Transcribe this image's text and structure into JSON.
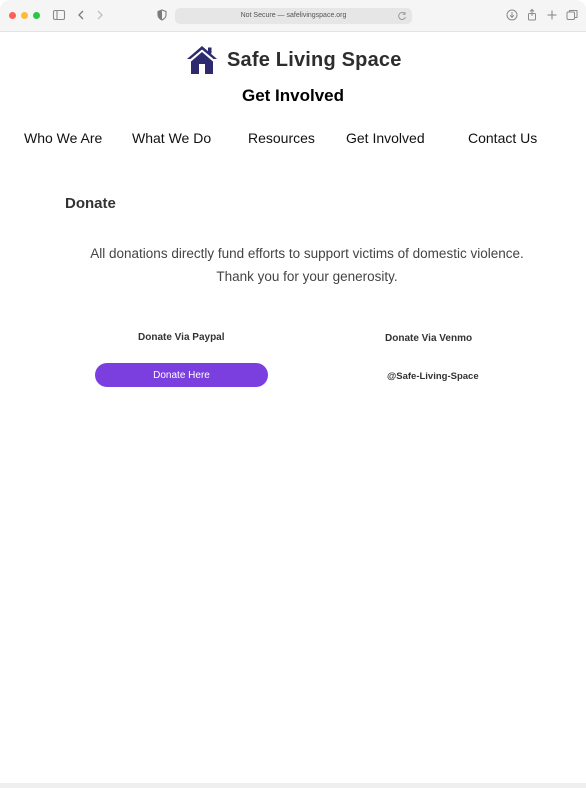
{
  "browser": {
    "address_text": "Not Secure — safelivingspace.org",
    "icons": [
      "sidebar-icon",
      "back-icon",
      "forward-icon",
      "privacy-shield-icon",
      "reload-icon",
      "download-icon",
      "share-icon",
      "new-tab-icon",
      "tabs-overview-icon"
    ]
  },
  "site": {
    "name": "Safe Living Space",
    "page_title": "Get Involved",
    "brand_color": "#2e2a6e"
  },
  "nav": {
    "items": [
      {
        "label": "Who We Are"
      },
      {
        "label": "What We Do"
      },
      {
        "label": "Resources"
      },
      {
        "label": "Get Involved"
      },
      {
        "label": "Contact Us"
      }
    ]
  },
  "donate": {
    "heading": "Donate",
    "blurb_line1": "All donations directly fund efforts to support victims of domestic violence.",
    "blurb_line2": "Thank you for your generosity.",
    "paypal_label": "Donate Via Paypal",
    "paypal_button": "Donate Here",
    "venmo_label": "Donate Via Venmo",
    "venmo_handle": "@Safe-Living-Space",
    "button_color": "#7b3fe0"
  }
}
